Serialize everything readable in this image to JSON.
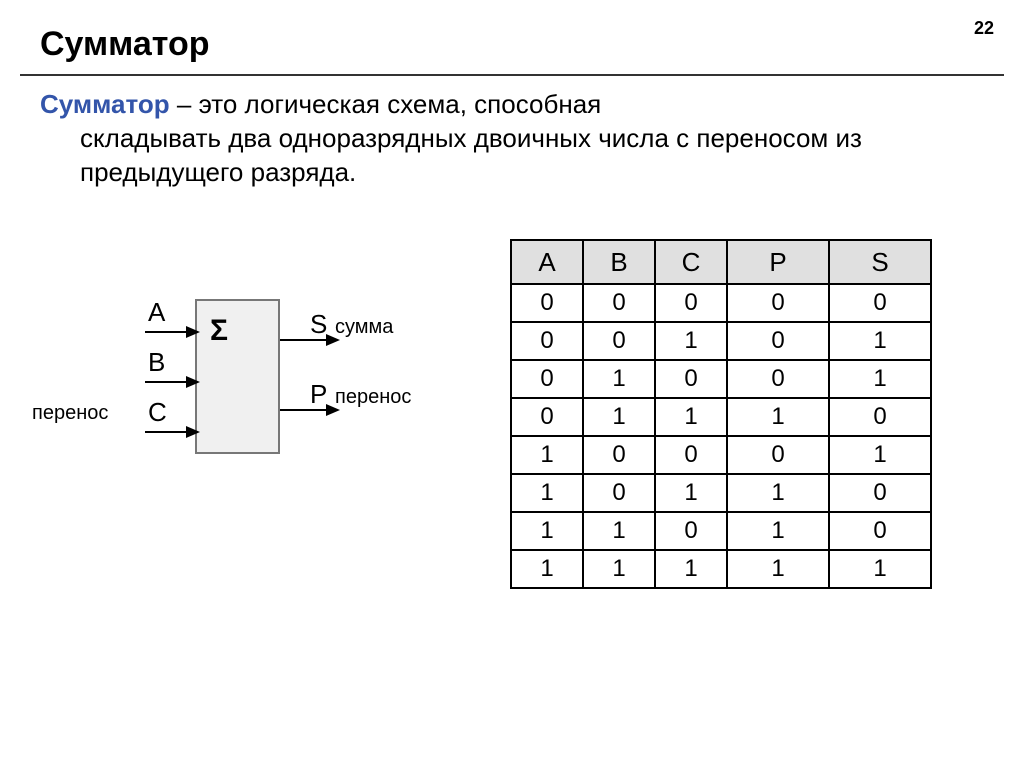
{
  "page_number": "22",
  "title": "Сумматор",
  "definition": {
    "term": "Сумматор",
    "dash": " – ",
    "tail_first": "это логическая схема, способная",
    "tail_rest": "складывать два одноразрядных двоичных числа с переносом из предыдущего разряда."
  },
  "diagram": {
    "sigma": "Σ",
    "inputs": {
      "A": "A",
      "B": "B",
      "C": "C"
    },
    "input_note": "перенос",
    "outputs": {
      "S": "S",
      "S_note": "сумма",
      "P": "P",
      "P_note": "перенос"
    }
  },
  "table": {
    "headers": [
      "A",
      "B",
      "C",
      "P",
      "S"
    ],
    "rows": [
      [
        "0",
        "0",
        "0",
        "0",
        "0"
      ],
      [
        "0",
        "0",
        "1",
        "0",
        "1"
      ],
      [
        "0",
        "1",
        "0",
        "0",
        "1"
      ],
      [
        "0",
        "1",
        "1",
        "1",
        "0"
      ],
      [
        "1",
        "0",
        "0",
        "0",
        "1"
      ],
      [
        "1",
        "0",
        "1",
        "1",
        "0"
      ],
      [
        "1",
        "1",
        "0",
        "1",
        "0"
      ],
      [
        "1",
        "1",
        "1",
        "1",
        "1"
      ]
    ]
  }
}
